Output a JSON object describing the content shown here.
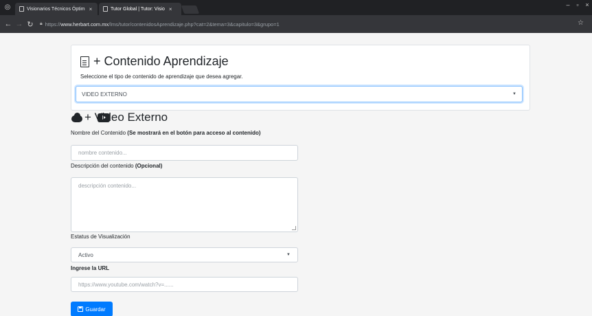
{
  "browser": {
    "tabs": [
      {
        "title": "Visionarios Técnicos Óptim"
      },
      {
        "title": "Tutor Global | Tutor: Visio"
      }
    ],
    "url_scheme": "https://",
    "url_host": "www.herbart.com.mx",
    "url_path": "/lms/tutor/contenidosAprendizaje.php?cat=2&tema=3&capitulo=3&grupo=1"
  },
  "card": {
    "title": "+ Contenido Aprendizaje",
    "subtitle": "Seleccione el tipo de contenido de aprendizaje que desea agregar.",
    "type_selected": "VIDEO EXTERNO"
  },
  "section": {
    "title": "+ Video Externo"
  },
  "form": {
    "name_label": "Nombre del Contenido",
    "name_label_bold": "(Se mostrará en el botón para acceso al contenido)",
    "name_placeholder": "nombre contenido...",
    "desc_label": "Descripción del contenido",
    "desc_label_bold": "(Opcional)",
    "desc_placeholder": "descripción contenido...",
    "status_label": "Estatus de Visualización",
    "status_selected": "Activo",
    "url_label": "Ingrese la URL",
    "url_placeholder": "https://www.youtube.com/watch?v=......",
    "save_label": "Guardar"
  },
  "colors": {
    "primary": "#007bff",
    "focus_border": "#80bdff"
  }
}
